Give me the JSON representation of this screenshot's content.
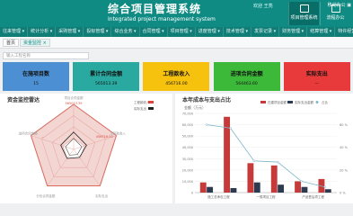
{
  "header": {
    "title": "综合项目管理系统",
    "subtitle": "Integrated project management system",
    "welcome": "欢迎 王亮",
    "btn_workbench": "项目管理系统",
    "btn_flow": "流程办公",
    "stamp": "移动办公 ▣"
  },
  "menu": [
    "往来管理 ▾",
    "统计分析 ▾",
    "采购管理 ▾",
    "投标管理 ▾",
    "综合业务 ▾",
    "合同管理 ▾",
    "项目管理 ▾",
    "进度管理 ▾",
    "技术管理 ▾",
    "发票记录 ▾",
    "财务管理 ▾",
    "结算管理 ▾",
    "特许经营 ▾"
  ],
  "tabs": [
    "首页",
    "资金监控 ×"
  ],
  "search": {
    "placeholder": "输入工程名称"
  },
  "kpis": [
    {
      "label": "在施项目数",
      "value": "15",
      "color": "#4c90d3"
    },
    {
      "label": "累计合同金额",
      "value": "565013.39",
      "color": "#2aa9a0"
    },
    {
      "label": "工程款收入",
      "value": "456716.00",
      "color": "#f6c20e"
    },
    {
      "label": "进项合同金额",
      "value": "564463.60",
      "color": "#3db93a"
    },
    {
      "label": "实际支出",
      "value": "—",
      "color": "#e83a3a"
    }
  ],
  "radar": {
    "title": "资金监控雷达",
    "legend": [
      "工程款收入",
      "实际支出"
    ],
    "labels": [
      "项目合同金额",
      "工程款收入",
      "实际支出",
      "分包合同金额",
      "进项合同金额"
    ],
    "values_outer": [
      "565013.39",
      "456716.00",
      "..."
    ],
    "values": [
      0.7,
      0.55,
      0.4,
      0.45,
      0.55
    ]
  },
  "chart_data": {
    "type": "bar",
    "title": "本年成本与支出占比",
    "ylabel": "金额（万元）",
    "categories": [
      "施工总承包工程",
      "一般项目工程",
      "产品售后项工程"
    ],
    "series": [
      {
        "name": "在建项目金额",
        "values": [
          9000,
          67000,
          26000,
          24000,
          10000,
          12000
        ]
      },
      {
        "name": "实际支出金额",
        "values": [
          5000,
          4000,
          9000,
          7000,
          5000,
          3000
        ]
      },
      {
        "name": "占比",
        "values": [
          60,
          57,
          28,
          27,
          10,
          5
        ]
      }
    ],
    "ylim": [
      0,
      70000
    ],
    "y2lim": [
      0,
      70
    ],
    "legend": "top"
  }
}
